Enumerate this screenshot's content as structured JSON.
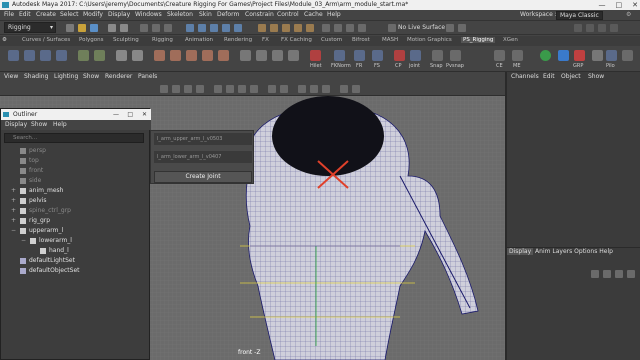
{
  "titlebar": {
    "title": "Autodesk Maya 2017: C:\\Users\\jeremy\\Documents\\Creature Rigging For Games\\Project Files\\Module_03_Arm\\arm_module_start.ma*",
    "minimize": "—",
    "maximize": "□",
    "close": "✕"
  },
  "menubar": {
    "items": [
      "File",
      "Edit",
      "Create",
      "Select",
      "Modify",
      "Display",
      "Windows",
      "Skeleton",
      "Skin",
      "Deform",
      "Constrain",
      "Control",
      "Cache",
      "Help"
    ],
    "workspace_label": "Workspace :",
    "workspace_value": "Maya Classic"
  },
  "statusline": {
    "menuset": "Rigging",
    "live_surface": "No Live Surface"
  },
  "shelf_tabs": [
    "Curves / Surfaces",
    "Polygons",
    "Sculpting",
    "Rigging",
    "Animation",
    "Rendering",
    "FX",
    "FX Caching",
    "Custom",
    "Bifrost",
    "MASH",
    "Motion Graphics",
    "PS_Rigging",
    "XGen"
  ],
  "shelf_active_tab": "PS_Rigging",
  "shelf_labels": [
    "Hilet",
    "FKNorm",
    "FR",
    "FS",
    "CP",
    "joint",
    "Snap",
    "Pvsnap",
    "CE",
    "ME",
    "GRP",
    "Pilo"
  ],
  "panel_menu": [
    "View",
    "Shading",
    "Lighting",
    "Show",
    "Renderer",
    "Panels"
  ],
  "right_panel": {
    "tabs": [
      "Channels",
      "Edit",
      "Object",
      "Show"
    ],
    "layer_tabs": [
      "Display",
      "Anim"
    ],
    "layer_menu": [
      "Layers",
      "Options",
      "Help"
    ]
  },
  "outliner": {
    "title": "Outliner",
    "menu": [
      "Display",
      "Show",
      "Help"
    ],
    "search_placeholder": "Search...",
    "items": [
      {
        "label": "persp",
        "dim": true
      },
      {
        "label": "top",
        "dim": true
      },
      {
        "label": "front",
        "dim": true
      },
      {
        "label": "side",
        "dim": true
      },
      {
        "label": "anim_mesh",
        "dim": false
      },
      {
        "label": "pelvis",
        "dim": false
      },
      {
        "label": "spine_ctrl_grp",
        "dim": true
      },
      {
        "label": "rig_grp",
        "dim": false
      },
      {
        "label": "upperarm_l",
        "dim": false
      },
      {
        "label": "lowerarm_l",
        "dim": false
      },
      {
        "label": "hand_l",
        "dim": false
      },
      {
        "label": "defaultLightSet",
        "dim": false
      },
      {
        "label": "defaultObjectSet",
        "dim": false
      }
    ]
  },
  "joint_tool": {
    "field1": "l_arm_upper_arm_l_v0503",
    "field2": "l_arm_lower_arm_l_v0407",
    "button": "Create Joint"
  },
  "viewport": {
    "camera": "front -Z"
  },
  "colors": {
    "accent": "#5ba0d0",
    "locator": "#e0402a",
    "mesh_lines": "#1a1a6a"
  }
}
